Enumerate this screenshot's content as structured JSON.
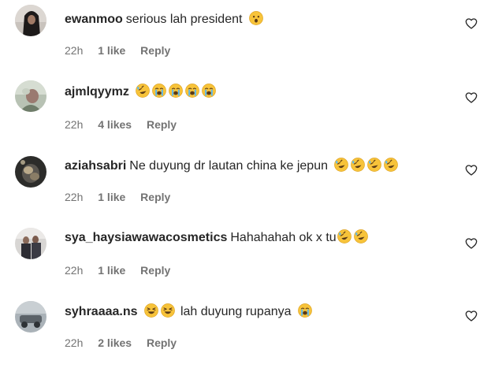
{
  "icons": {
    "heart": "heart-outline-icon",
    "emoji_laugh": "rolling-on-floor-laughing-emoji",
    "emoji_cry": "loudly-crying-emoji",
    "emoji_surprised": "hushed-face-emoji",
    "emoji_grin": "grinning-squinting-emoji"
  },
  "colors": {
    "text": "#262626",
    "meta": "#737373",
    "emoji_yellow": "#f7c33a"
  },
  "comments": [
    {
      "username": "ewanmoo",
      "text": "serious lah president",
      "time": "22h",
      "likes": "1 like",
      "reply": "Reply"
    },
    {
      "username": "ajmlqyymz",
      "text": "",
      "time": "22h",
      "likes": "4 likes",
      "reply": "Reply"
    },
    {
      "username": "aziahsabri",
      "text": "Ne duyung dr lautan china ke jepun",
      "time": "22h",
      "likes": "1 like",
      "reply": "Reply"
    },
    {
      "username": "sya_haysiawawacosmetics",
      "text": "Hahahahah ok x tu",
      "time": "22h",
      "likes": "1 like",
      "reply": "Reply"
    },
    {
      "username": "syhraaaa.ns",
      "text": "lah duyung rupanya",
      "time": "22h",
      "likes": "2 likes",
      "reply": "Reply"
    }
  ]
}
